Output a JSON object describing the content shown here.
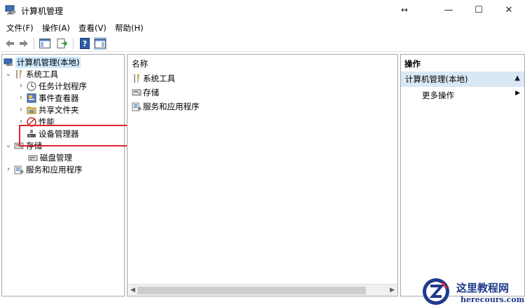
{
  "window": {
    "title": "计算机管理",
    "resize_glyph": "↔",
    "minimize_glyph": "—",
    "maximize_glyph": "☐",
    "close_glyph": "✕"
  },
  "menu": {
    "file": "文件(F)",
    "action": "操作(A)",
    "view": "查看(V)",
    "help": "帮助(H)"
  },
  "toolbar": {
    "icons": [
      "back-icon",
      "forward-icon",
      "show-hide-console-tree-icon",
      "export-list-icon",
      "help-icon",
      "show-action-pane-icon"
    ]
  },
  "tree": {
    "root": "计算机管理(本地)",
    "system_tools": "系统工具",
    "task_scheduler": "任务计划程序",
    "event_viewer": "事件查看器",
    "shared_folders": "共享文件夹",
    "performance": "性能",
    "device_manager": "设备管理器",
    "storage": "存储",
    "disk_management": "磁盘管理",
    "services_apps": "服务和应用程序"
  },
  "list": {
    "column_name": "名称",
    "items": [
      "系统工具",
      "存储",
      "服务和应用程序"
    ]
  },
  "actions": {
    "title": "操作",
    "section": "计算机管理(本地)",
    "more": "更多操作"
  },
  "watermark": {
    "title": "这里教程网",
    "subtitle": "herecours.com"
  },
  "colors": {
    "highlight": "#e0242f",
    "actions_header_bg": "#d9e8f5",
    "selection_bg": "#cce8ff"
  }
}
